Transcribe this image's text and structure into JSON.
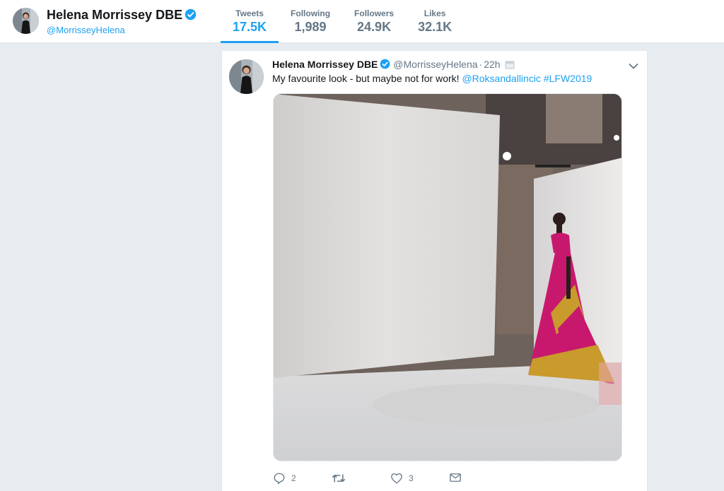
{
  "profile": {
    "name": "Helena Morrissey DBE",
    "handle": "@MorrisseyHelena"
  },
  "stats": [
    {
      "label": "Tweets",
      "value": "17.5K"
    },
    {
      "label": "Following",
      "value": "1,989"
    },
    {
      "label": "Followers",
      "value": "24.9K"
    },
    {
      "label": "Likes",
      "value": "32.1K"
    }
  ],
  "tweet": {
    "name": "Helena Morrissey DBE",
    "handle": "@MorrisseyHelena",
    "separator": "·",
    "time": "22h",
    "text": "My favourite look - but maybe not for work! ",
    "mention": "@Roksandallincic",
    "hashtag": "#LFW2019",
    "reply_count": "2",
    "retweet_count": "",
    "like_count": "3"
  },
  "icons": {
    "verified": "verified-badge-icon",
    "caret": "chevron-down-icon",
    "reply": "reply-icon",
    "retweet": "retweet-icon",
    "like": "heart-icon",
    "message": "envelope-icon"
  },
  "colors": {
    "accent": "#1da1f2",
    "background": "#e6ecf0",
    "muted_text": "#657786",
    "dress_magenta": "#c8186e",
    "dress_mustard": "#c99a2c"
  }
}
